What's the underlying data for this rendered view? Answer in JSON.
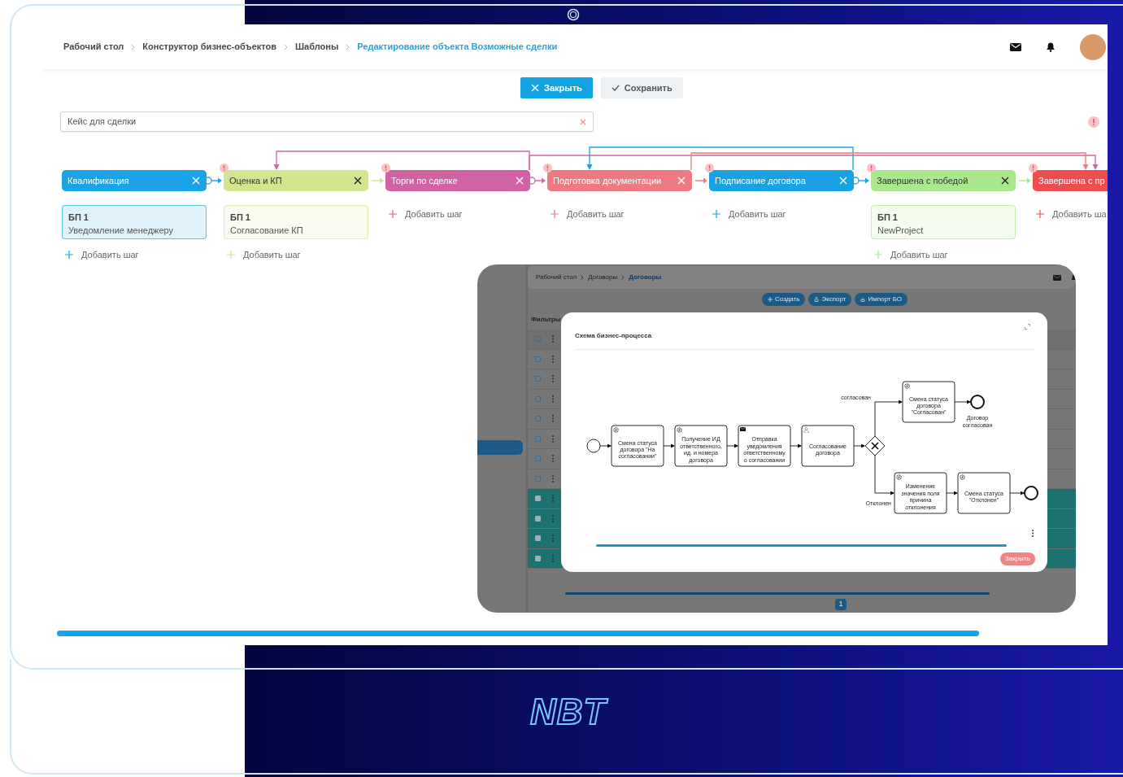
{
  "header": {
    "breadcrumbs": [
      {
        "label": "Рабочий стол",
        "current": false
      },
      {
        "label": "Конструктор бизнес-объектов",
        "current": false
      },
      {
        "label": "Шаблоны",
        "current": false
      },
      {
        "label": "Редактирование объекта Возможные сделки",
        "current": true
      }
    ]
  },
  "toolbar": {
    "buttons": [
      {
        "kind": "primary",
        "label": "Закрыть"
      },
      {
        "kind": "secondary",
        "label": "Сохранить"
      }
    ]
  },
  "case_field": {
    "value": "Кейс для сделки"
  },
  "stages": [
    {
      "label": "Квалификация",
      "color": "#1aa3e6",
      "dot": true,
      "warning": false,
      "steps": [
        {
          "title": "БП 1",
          "name": "Уведомление менеджеру"
        }
      ],
      "add_step_label": "Добавить шаг"
    },
    {
      "label": "Оценка и КП",
      "color": "#d3e58e",
      "dot": false,
      "warning": true,
      "steps": [
        {
          "title": "БП 1",
          "name": "Согласование КП"
        }
      ],
      "add_step_label": "Добавить шаг"
    },
    {
      "label": "Торги по сделке",
      "color": "#d263a3",
      "dot": true,
      "warning": true,
      "add_step_label": "Добавить шаг"
    },
    {
      "label": "Подготовка документации",
      "color": "#ec7a80",
      "dot": false,
      "warning": true,
      "add_step_label": "Добавить шаг"
    },
    {
      "label": "Подписание договора",
      "color": "#18a2e4",
      "dot": true,
      "warning": true,
      "add_step_label": "Добавить шаг"
    },
    {
      "label": "Завершена с победой",
      "color": "#a9e88c",
      "dot": false,
      "warning": true,
      "steps": [
        {
          "title": "БП 1",
          "name": "NewProject"
        }
      ],
      "add_step_label": "Добавить шаг"
    },
    {
      "label": "Завершена с пр",
      "color": "#ee4d4f",
      "warning": true,
      "add_step_label": "Добавить ша"
    }
  ],
  "inset": {
    "breadcrumbs": [
      "Рабочий стол",
      "Договоры",
      "Договоры"
    ],
    "buttons": [
      {
        "kind": "create",
        "label": "Создать"
      },
      {
        "kind": "export",
        "label": "Экспорт"
      },
      {
        "kind": "import",
        "label": "Импорт БО"
      }
    ],
    "filters_label": "Фильтры",
    "rows": [
      {
        "selected": false
      },
      {
        "selected": false
      },
      {
        "selected": false
      },
      {
        "selected": false
      },
      {
        "selected": false
      },
      {
        "selected": false
      },
      {
        "selected": false
      },
      {
        "selected": false
      },
      {
        "selected": true
      },
      {
        "selected": true
      },
      {
        "selected": true
      },
      {
        "selected": true
      }
    ],
    "page": "1",
    "modal": {
      "title": "Схема бизнес-процесса",
      "close_label": "Закрыть",
      "diagram": {
        "tasks": [
          {
            "kind": "service",
            "lines": [
              "Смена статуса",
              "договора \"На",
              "согласовании\""
            ]
          },
          {
            "kind": "service",
            "lines": [
              "Получение ИД",
              "ответственного,",
              "ид. и номера",
              "договора"
            ]
          },
          {
            "kind": "message",
            "lines": [
              "Отправка",
              "уведомления",
              "ответственному",
              "о согласовании"
            ]
          },
          {
            "kind": "user",
            "lines": [
              "Согласование",
              "договора"
            ]
          },
          {
            "kind": "service",
            "lines": [
              "Смена статуса",
              "договора",
              "\"Согласован\""
            ]
          },
          {
            "kind": "service",
            "lines": [
              "Изменение",
              "значения поля",
              "причина",
              "отклонения"
            ]
          },
          {
            "kind": "service",
            "lines": [
              "Смена статуса",
              "\"Отклонен\""
            ]
          }
        ],
        "branches": [
          "согласован",
          "Отклонен"
        ],
        "end_label": [
          "Договор",
          "согласован"
        ]
      }
    }
  },
  "logo": {
    "text": "NBT"
  }
}
